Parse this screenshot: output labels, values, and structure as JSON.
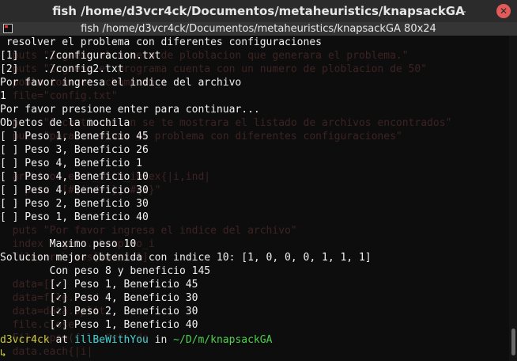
{
  "window": {
    "title": "fish /home/d3vcr4ck/Documentos/metaheuristics/knapsackGA",
    "dash_glyph": "–",
    "close_glyph": "✕"
  },
  "tab": {
    "label": "fish /home/d3vcr4ck/Documentos/metaheuristics/knapsackGA 80x24"
  },
  "background_code": [
    "  puts \"Ingresa el numero de ploblacion que generara el problema.\"",
    "  puts \"Ingresa el programa cuenta con un numero de ploblacion de 50\"",
    "  poblacion=gets.chomp.to_i",
    "  file=\"config.txt\"",
    "  puts \"A continuacion se te mostrara el listado de archivos encontrados\"",
    "  puts \"para resolver el problema con diferentes configuraciones\"",
    "",
    "  archivos.each_with_index{|i,ind|",
    "    puts \"[#{ind+1}] #{i}\"",
    "  }",
    "",
    "  puts \"Por favor ingresa el indice del archivo\"",
    "  index = gets.chomp.to_i",
    "  file=archivos[index-1]",
    "  data=[]",
    "  data=file.read",
    "  data=data.split",
    "  file.close",
    "  File.open(file,\"r\") do",
    "",
    "  data.each{|i|"
  ],
  "output": [
    " resolver el problema con diferentes configuraciones",
    "[1]    ./configuracion.txt",
    "[2]    ./config2.txt",
    "Por favor ingresa el indice del archivo",
    "1",
    "Por favor presione enter para continuar...",
    "Objetos de la mochila",
    "[ ] Peso 1, Beneficio 45",
    "[ ] Peso 3, Beneficio 26",
    "[ ] Peso 4, Beneficio 1",
    "[ ] Peso 4, Beneficio 10",
    "[ ] Peso 4, Beneficio 30",
    "[ ] Peso 2, Beneficio 30",
    "[ ] Peso 1, Beneficio 40",
    "",
    "        Maximo peso 10",
    "Solucion mejor obtenida con indice 10: [1, 0, 0, 0, 1, 1, 1]",
    "        Con peso 8 y beneficio 145",
    "        [✓] Peso 1, Beneficio 45",
    "        [✓] Peso 4, Beneficio 30",
    "        [✓] Peso 2, Beneficio 30",
    "        [✓] Peso 1, Beneficio 40"
  ],
  "prompt": {
    "user": "d3vcr4ck",
    "at": " at ",
    "host": "illBeWithYou",
    "in": " in ",
    "path": "~/D/m/knapsackGA",
    "arrow": "↳"
  },
  "colors": {
    "terminal_bg": "#0d0d0d",
    "titlebar_bg": "#2b2b2b",
    "prompt_user": "#c7c73a",
    "prompt_host": "#3fd2d2",
    "prompt_path": "#4ed04e",
    "close_button": "#e35a5a"
  }
}
